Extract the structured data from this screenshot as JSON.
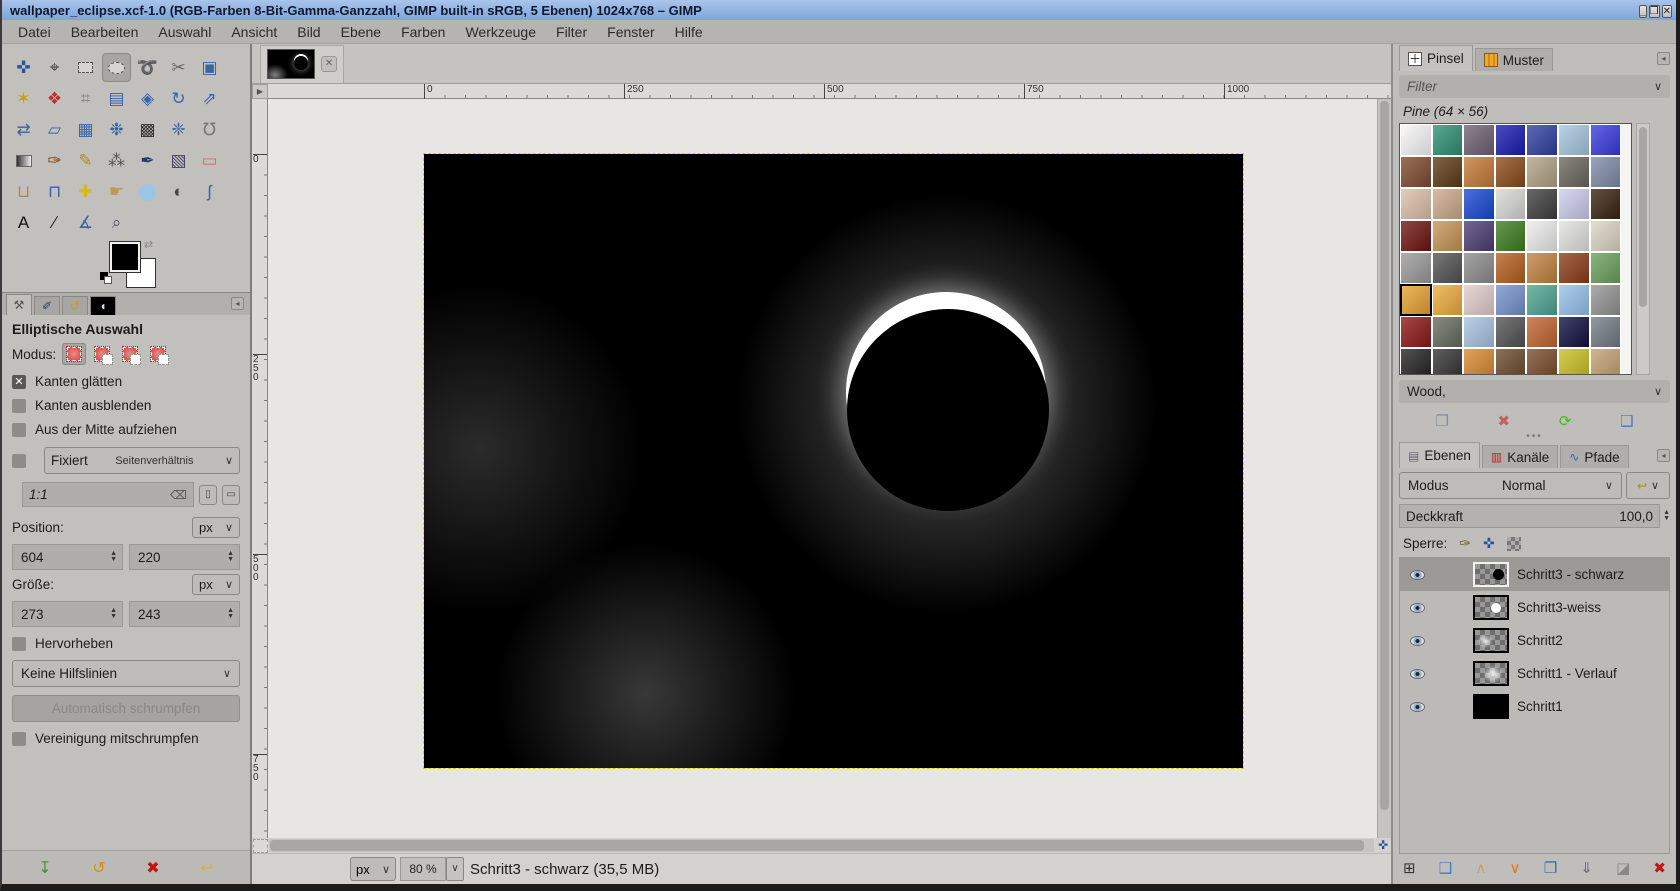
{
  "window": {
    "title": "wallpaper_eclipse.xcf-1.0 (RGB-Farben 8-Bit-Gamma-Ganzzahl, GIMP built-in sRGB, 5 Ebenen) 1024x768 – GIMP",
    "controls": [
      {
        "name": "minimize-button",
        "icon": "minimize"
      },
      {
        "name": "maximize-button",
        "icon": "maximize"
      },
      {
        "name": "close-button",
        "icon": "close"
      }
    ]
  },
  "menubar": {
    "items": [
      "Datei",
      "Bearbeiten",
      "Auswahl",
      "Ansicht",
      "Bild",
      "Ebene",
      "Farben",
      "Werkzeuge",
      "Filter",
      "Fenster",
      "Hilfe"
    ]
  },
  "toolbox": {
    "tools": [
      {
        "name": "move"
      },
      {
        "name": "align"
      },
      {
        "name": "rectangle-select"
      },
      {
        "name": "ellipse-select",
        "active": true
      },
      {
        "name": "free-select"
      },
      {
        "name": "scissors-select"
      },
      {
        "name": "foreground-select"
      },
      {
        "name": "fuzzy-select"
      },
      {
        "name": "select-by-color"
      },
      {
        "name": "cage-transform"
      },
      {
        "name": "crop"
      },
      {
        "name": "unified-transform"
      },
      {
        "name": "rotate"
      },
      {
        "name": "scale"
      },
      {
        "name": "flip"
      },
      {
        "name": "perspective"
      },
      {
        "name": "3d-transform"
      },
      {
        "name": "npoint-deformation"
      },
      {
        "name": "warp-transform"
      },
      {
        "name": "handle-transform"
      },
      {
        "name": "bucket-fill"
      },
      {
        "name": "gradient"
      },
      {
        "name": "paintbrush"
      },
      {
        "name": "pencil"
      },
      {
        "name": "airbrush"
      },
      {
        "name": "ink"
      },
      {
        "name": "mypaint-brush"
      },
      {
        "name": "eraser"
      },
      {
        "name": "clone"
      },
      {
        "name": "perspective-clone"
      },
      {
        "name": "heal"
      },
      {
        "name": "smudge"
      },
      {
        "name": "blur-sharpen"
      },
      {
        "name": "dodge-burn"
      },
      {
        "name": "paths"
      },
      {
        "name": "text"
      },
      {
        "name": "color-picker"
      },
      {
        "name": "measure"
      },
      {
        "name": "zoom"
      }
    ],
    "foreground_color": "#000000",
    "background_color": "#ffffff"
  },
  "tool_options": {
    "tabs": [
      {
        "name": "tab-tool-options",
        "icon": "tool-options",
        "active": true
      },
      {
        "name": "tab-device-status",
        "icon": "device-status"
      },
      {
        "name": "tab-undo-history",
        "icon": "undo-history"
      },
      {
        "name": "tab-image-thumbnail",
        "icon": "image-thumb"
      }
    ],
    "title": "Elliptische Auswahl",
    "mode_label": "Modus:",
    "modes": [
      {
        "name": "mode-replace",
        "active": true,
        "variant": "rep"
      },
      {
        "name": "mode-add",
        "variant": "add"
      },
      {
        "name": "mode-subtract",
        "variant": "sub"
      },
      {
        "name": "mode-intersect",
        "variant": "int"
      }
    ],
    "checkboxes": [
      {
        "label": "Kanten glätten",
        "checked": true
      },
      {
        "label": "Kanten ausblenden",
        "checked": false
      },
      {
        "label": "Aus der Mitte aufziehen",
        "checked": false
      }
    ],
    "fixed": {
      "checked": false,
      "label": "Fixiert",
      "value": "Seitenverhältnis"
    },
    "ratio_value": "1:1",
    "position": {
      "label": "Position:",
      "unit": "px",
      "x": "604",
      "y": "220"
    },
    "size": {
      "label": "Größe:",
      "unit": "px",
      "w": "273",
      "h": "243"
    },
    "highlight": {
      "label": "Hervorheben",
      "checked": false
    },
    "guides_value": "Keine Hilfslinien",
    "shrink_button": "Automatisch schrumpfen",
    "shrink_merged": {
      "label": "Vereinigung mitschrumpfen",
      "checked": false
    },
    "footer_buttons": [
      {
        "name": "save-options-button",
        "icon": "save"
      },
      {
        "name": "restore-options-button",
        "icon": "restore"
      },
      {
        "name": "delete-options-button",
        "icon": "delete"
      },
      {
        "name": "reset-options-button",
        "icon": "reset"
      }
    ]
  },
  "canvas": {
    "ruler_h": [
      {
        "label": "0",
        "pos": 156
      },
      {
        "label": "250",
        "pos": 356
      },
      {
        "label": "500",
        "pos": 556
      },
      {
        "label": "750",
        "pos": 756
      },
      {
        "label": "1000",
        "pos": 956
      }
    ],
    "ruler_v": [
      {
        "label": "0",
        "pos": 55
      },
      {
        "label": "250",
        "pos": 255
      },
      {
        "label": "500",
        "pos": 455
      },
      {
        "label": "750",
        "pos": 655
      }
    ],
    "statusbar": {
      "unit": "px",
      "zoom": "80 %",
      "status": "Schritt3 - schwarz (35,5 MB)"
    }
  },
  "right_panel": {
    "brush_tabs": [
      {
        "label": "Pinsel",
        "name": "tab-pinsel",
        "active": true,
        "icon": "brush-tab"
      },
      {
        "label": "Muster",
        "name": "tab-muster",
        "active": false,
        "icon": "pattern-tab"
      }
    ],
    "filter_placeholder": "Filter",
    "brush_name": "Pine (64 × 56)",
    "patterns": {
      "selected_index": 35,
      "colors": [
        "#f8f8f8",
        "#2e8f72",
        "#6f5f72",
        "#1a1ab0",
        "#2f3f9e",
        "#a6c6de",
        "#3a3ae0",
        "#7d4a2e",
        "#5c3a16",
        "#c47a36",
        "#8a4a18",
        "#b2a284",
        "#6a665e",
        "#7e8ca8",
        "#dcc0a8",
        "#cbaa8a",
        "#1848d4",
        "#d8d8d6",
        "#3e3e3e",
        "#ccccec",
        "#38220e",
        "#6e1410",
        "#c69454",
        "#4c3c74",
        "#3e7c20",
        "#ececec",
        "#e2e2e0",
        "#dcd6c4",
        "#9a9a9a",
        "#525252",
        "#8c8c8c",
        "#b45e1e",
        "#c28240",
        "#8c3c18",
        "#6aa05c",
        "#e8a232",
        "#ecac3c",
        "#e2cccc",
        "#7492cc",
        "#4ea492",
        "#96c2ec",
        "#949494",
        "#8c1616",
        "#646c5c",
        "#aac2e2",
        "#525252",
        "#c26430",
        "#101040",
        "#737b84",
        "#222222",
        "#333333",
        "#d88830",
        "#6a4a2a",
        "#7a4a2a",
        "#c8c020",
        "#c2a272"
      ]
    },
    "pattern_name": "Wood,",
    "pattern_actions": [
      {
        "name": "duplicate-pattern-button",
        "icon": "duplicate"
      },
      {
        "name": "delete-pattern-button",
        "icon": "delete"
      },
      {
        "name": "refresh-patterns-button",
        "icon": "refresh"
      },
      {
        "name": "open-pattern-folder-button",
        "icon": "folder-open"
      }
    ],
    "dock_tabs": [
      {
        "label": "Ebenen",
        "name": "tab-ebenen",
        "active": true,
        "icon": "layers-tab"
      },
      {
        "label": "Kanäle",
        "name": "tab-kanaele",
        "active": false,
        "icon": "channels-tab"
      },
      {
        "label": "Pfade",
        "name": "tab-pfade",
        "active": false,
        "icon": "paths-tab"
      }
    ],
    "mode": {
      "label": "Modus",
      "value": "Normal"
    },
    "opacity": {
      "label": "Deckkraft",
      "value": "100,0"
    },
    "lock_label": "Sperre:",
    "lock_icons": [
      "lock-pixels",
      "lock-position",
      "lock-alpha"
    ],
    "layers": [
      {
        "name": "Schritt3 - schwarz",
        "thumb": "checker-black-dot",
        "selected": true
      },
      {
        "name": "Schritt3-weiss",
        "thumb": "checker-white-dot",
        "selected": false
      },
      {
        "name": "Schritt2",
        "thumb": "checker-glow",
        "selected": false
      },
      {
        "name": "Schritt1 - Verlauf",
        "thumb": "checker-glow-center",
        "selected": false
      },
      {
        "name": "Schritt1",
        "thumb": "black",
        "selected": false
      }
    ],
    "layer_actions": [
      {
        "name": "new-layer-button",
        "icon": "new-layer"
      },
      {
        "name": "new-layer-group-button",
        "icon": "new-group"
      },
      {
        "name": "raise-layer-button",
        "icon": "raise"
      },
      {
        "name": "lower-layer-button",
        "icon": "lower"
      },
      {
        "name": "duplicate-layer-button",
        "icon": "duplicate"
      },
      {
        "name": "merge-down-button",
        "icon": "merge-down"
      },
      {
        "name": "layer-mask-button",
        "icon": "layer-mask"
      },
      {
        "name": "delete-layer-button",
        "icon": "delete"
      }
    ]
  }
}
